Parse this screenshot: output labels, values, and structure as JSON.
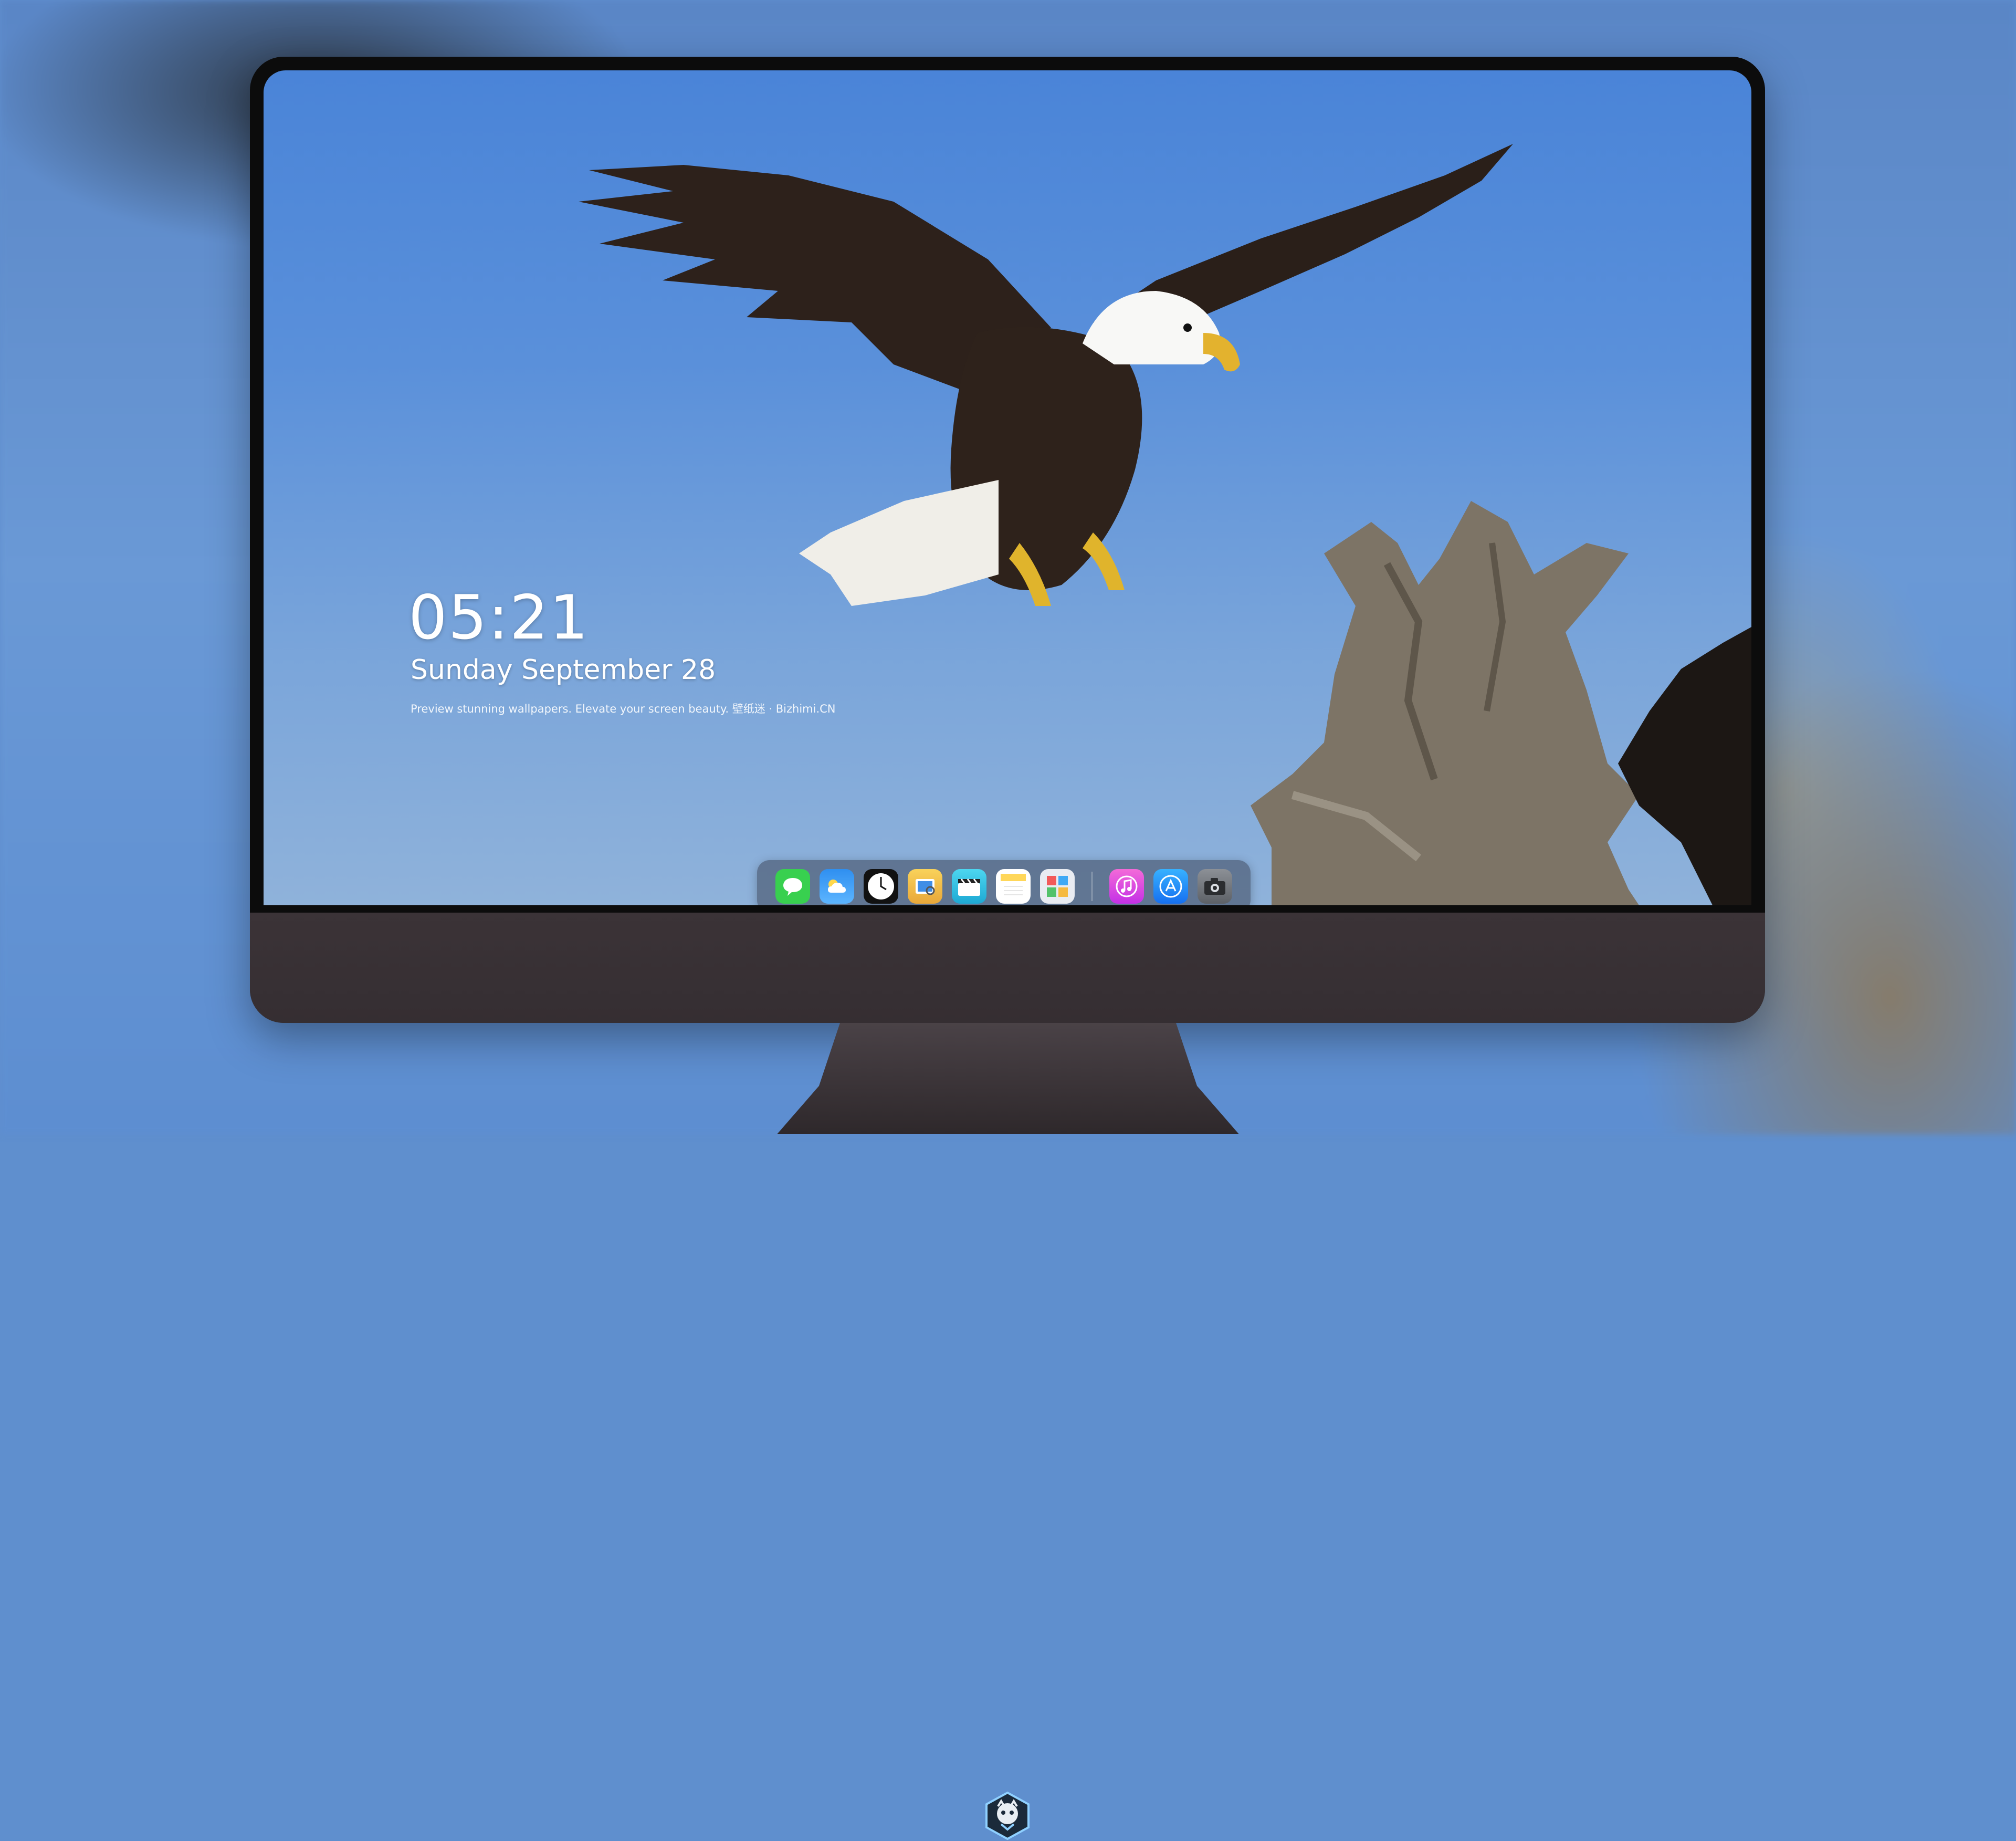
{
  "lockscreen": {
    "time": "05:21",
    "date": "Sunday September  28",
    "tagline": "Preview stunning wallpapers. Elevate your screen beauty. 壁纸迷 · Bizhimi.CN"
  },
  "dock": {
    "apps": [
      {
        "name": "messages-icon",
        "glyph": "💬",
        "color": "#38d04f"
      },
      {
        "name": "weather-icon",
        "glyph": "⛅",
        "color": "#2f8ff0"
      },
      {
        "name": "clock-icon",
        "glyph": "🕔",
        "color": "#ffffff"
      },
      {
        "name": "preview-icon",
        "glyph": "🖼",
        "color": "#f3c64a"
      },
      {
        "name": "clips-icon",
        "glyph": "🎬",
        "color": "#3cc6e6"
      },
      {
        "name": "notes-icon",
        "glyph": "📝",
        "color": "#ffe27a"
      },
      {
        "name": "photo-booth-icon",
        "glyph": "🧩",
        "color": "#e9ecf2"
      }
    ],
    "apps_right": [
      {
        "name": "music-icon",
        "glyph": "♫",
        "color": "#e84ae0"
      },
      {
        "name": "app-store-icon",
        "glyph": "Ⓐ",
        "color": "#1f8df5"
      },
      {
        "name": "camera-icon",
        "glyph": "📷",
        "color": "#6b6f75"
      }
    ]
  },
  "colors": {
    "sky": "#5a90da",
    "chin": "#3a3236",
    "dock_bg": "rgba(60,70,90,0.55)"
  }
}
